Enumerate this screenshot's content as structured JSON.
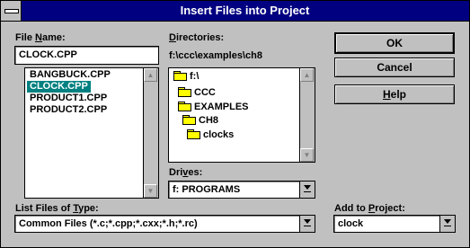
{
  "window": {
    "title": "Insert Files into Project"
  },
  "file_name": {
    "label_pre": "File ",
    "label_u": "N",
    "label_post": "ame:",
    "value": "CLOCK.CPP"
  },
  "file_list": {
    "items": [
      "BANGBUCK.CPP",
      "CLOCK.CPP",
      "PRODUCT1.CPP",
      "PRODUCT2.CPP"
    ],
    "selected": "CLOCK.CPP"
  },
  "directories": {
    "label_u": "D",
    "label_post": "irectories:",
    "current_path": "f:\\ccc\\examples\\ch8",
    "items": [
      {
        "name": "f:\\",
        "open": true
      },
      {
        "name": "CCC",
        "open": true
      },
      {
        "name": "EXAMPLES",
        "open": true
      },
      {
        "name": "CH8",
        "open": true
      },
      {
        "name": "clocks",
        "open": false
      }
    ]
  },
  "drives": {
    "label_pre": "Dri",
    "label_u": "v",
    "label_post": "es:",
    "value": "f: PROGRAMS"
  },
  "file_type": {
    "label_pre": "List Files of ",
    "label_u": "T",
    "label_post": "ype:",
    "value": "Common Files (*.c;*.cpp;*.cxx;*.h;*.rc)"
  },
  "add_to_project": {
    "label_pre": "Add to ",
    "label_u": "P",
    "label_post": "roject:",
    "value": "clock"
  },
  "buttons": {
    "ok": "OK",
    "cancel": "Cancel",
    "help_u": "H",
    "help_post": "elp"
  },
  "colors": {
    "title_bar": "#000080",
    "selection": "#008080",
    "face": "#c0c0c0",
    "folder": "#ffff00"
  },
  "icons": [
    "system-menu-icon",
    "folder-open-icon",
    "folder-closed-icon",
    "scroll-up-icon",
    "scroll-down-icon",
    "dropdown-arrow-icon"
  ]
}
